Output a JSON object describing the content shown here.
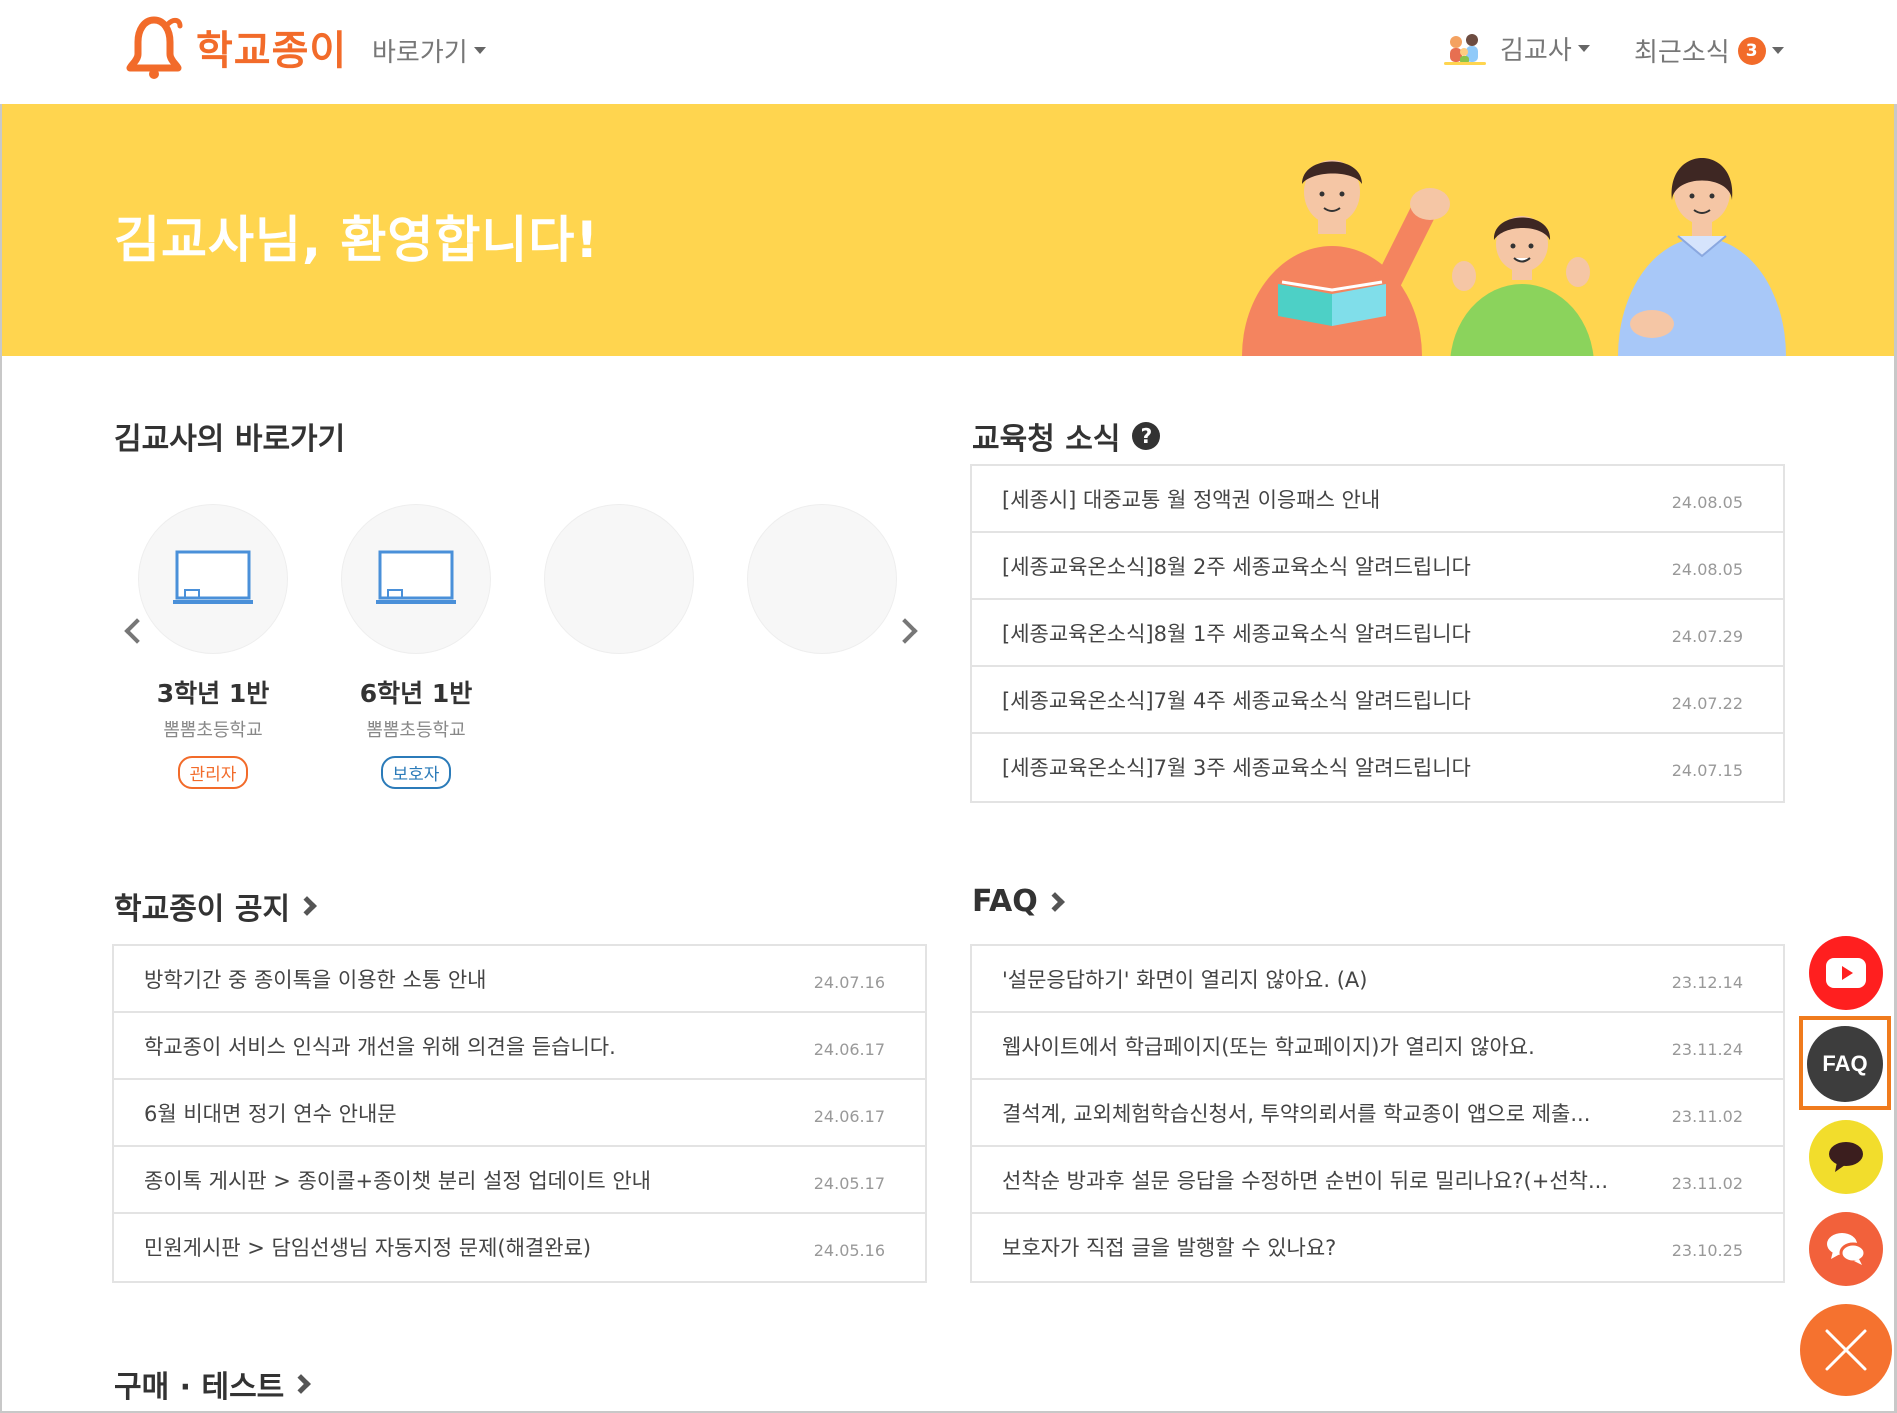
{
  "header": {
    "logo_text": "학교종이",
    "shortcut_menu": "바로가기",
    "user_name": "김교사",
    "news_label": "최근소식",
    "news_count": "3"
  },
  "banner": {
    "welcome": "김교사님, 환영합니다!"
  },
  "shortcuts": {
    "title": "김교사의 바로가기",
    "classes": [
      {
        "name": "3학년 1반",
        "school": "뽐뽐초등학교",
        "role": "관리자"
      },
      {
        "name": "6학년 1반",
        "school": "뽐뽐초등학교",
        "role": "보호자"
      }
    ]
  },
  "office_news": {
    "title": "교육청 소식",
    "items": [
      {
        "title": "[세종시] 대중교통 월 정액권 이응패스 안내",
        "date": "24.08.05"
      },
      {
        "title": "[세종교육온소식]8월 2주 세종교육소식 알려드립니다",
        "date": "24.08.05"
      },
      {
        "title": "[세종교육온소식]8월 1주 세종교육소식 알려드립니다",
        "date": "24.07.29"
      },
      {
        "title": "[세종교육온소식]7월 4주 세종교육소식 알려드립니다",
        "date": "24.07.22"
      },
      {
        "title": "[세종교육온소식]7월 3주 세종교육소식 알려드립니다",
        "date": "24.07.15"
      }
    ]
  },
  "notices": {
    "title": "학교종이 공지",
    "items": [
      {
        "title": "방학기간 중 종이톡을 이용한 소통 안내",
        "date": "24.07.16"
      },
      {
        "title": "학교종이 서비스 인식과 개선을 위해 의견을 듣습니다.",
        "date": "24.06.17"
      },
      {
        "title": "6월 비대면 정기 연수 안내문",
        "date": "24.06.17"
      },
      {
        "title": "종이톡 게시판 > 종이콜+종이챗 분리 설정 업데이트 안내",
        "date": "24.05.17"
      },
      {
        "title": "민원게시판 > 담임선생님 자동지정 문제(해결완료)",
        "date": "24.05.16"
      }
    ]
  },
  "faq": {
    "title": "FAQ",
    "items": [
      {
        "title": "'설문응답하기' 화면이 열리지 않아요. (A)",
        "date": "23.12.14"
      },
      {
        "title": "웹사이트에서 학급페이지(또는 학교페이지)가 열리지 않아요.",
        "date": "23.11.24"
      },
      {
        "title": "결석계, 교외체험학습신청서, 투약의뢰서를 학교종이 앱으로 제출...",
        "date": "23.11.02"
      },
      {
        "title": "선착순 방과후 설문 응답을 수정하면 순번이 뒤로 밀리나요?(+선착...",
        "date": "23.11.02"
      },
      {
        "title": "보호자가 직접 글을 발행할 수 있나요?",
        "date": "23.10.25"
      }
    ]
  },
  "purchase": {
    "title": "구매 · 테스트"
  },
  "floating": {
    "faq_label": "FAQ"
  },
  "colors": {
    "brand": "#f26b2a",
    "banner": "#ffd54f"
  }
}
